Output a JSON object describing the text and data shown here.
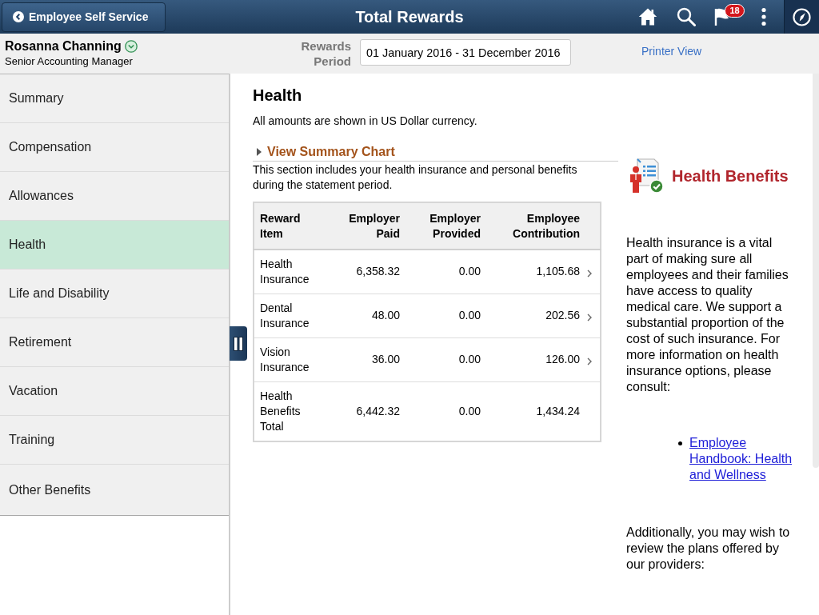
{
  "header": {
    "back_button": "Employee Self Service",
    "title": "Total Rewards",
    "notification_count": "18"
  },
  "employee": {
    "name": "Rosanna Channing",
    "job_title": "Senior Accounting Manager"
  },
  "rewards_period": {
    "label": "Rewards Period",
    "value": "01 January 2016 - 31 December 2016"
  },
  "printer_view_link": "Printer View",
  "sidebar": {
    "items": [
      {
        "label": "Summary",
        "selected": false
      },
      {
        "label": "Compensation",
        "selected": false
      },
      {
        "label": "Allowances",
        "selected": false
      },
      {
        "label": "Health",
        "selected": true
      },
      {
        "label": "Life and Disability",
        "selected": false
      },
      {
        "label": "Retirement",
        "selected": false
      },
      {
        "label": "Vacation",
        "selected": false
      },
      {
        "label": "Training",
        "selected": false
      },
      {
        "label": "Other Benefits",
        "selected": false
      }
    ]
  },
  "section": {
    "title": "Health",
    "currency_note": "All amounts are shown in US Dollar currency.",
    "summary_chart_toggle": {
      "label": "View Summary Chart",
      "expanded": false
    },
    "description": "This section includes your health insurance and personal benefits during the statement period.",
    "table": {
      "columns": [
        "Reward Item",
        "Employer Paid",
        "Employer Provided",
        "Employee Contribution"
      ],
      "rows": [
        {
          "cells": [
            "Health Insurance",
            "6,358.32",
            "0.00",
            "1,105.68"
          ],
          "has_details": true
        },
        {
          "cells": [
            "Dental Insurance",
            "48.00",
            "0.00",
            "202.56"
          ],
          "has_details": true
        },
        {
          "cells": [
            "Vision Insurance",
            "36.00",
            "0.00",
            "126.00"
          ],
          "has_details": true
        },
        {
          "cells": [
            "Health Benefits Total",
            "6,442.32",
            "0.00",
            "1,434.24"
          ],
          "has_details": false
        }
      ]
    }
  },
  "info_panel": {
    "title": "Health Benefits",
    "intro": "Health insurance is a vital part of making sure all employees and their families have access to quality medical care. We support a substantial proportion of the cost of such insurance. For more information on health insurance options, please consult:",
    "links": [
      "Employee Handbook: Health and Wellness"
    ],
    "closing": "Additionally, you may wish to review the plans offered by our providers:"
  }
}
